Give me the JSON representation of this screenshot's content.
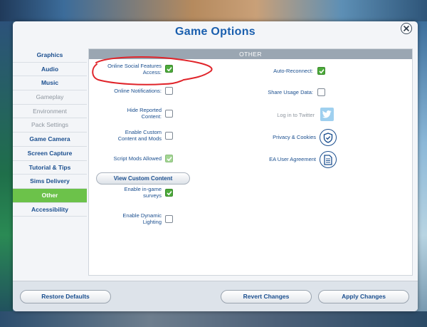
{
  "dialog": {
    "title": "Game Options",
    "close_icon": "close-icon"
  },
  "sidebar": {
    "items": [
      {
        "label": "Graphics",
        "state": "normal"
      },
      {
        "label": "Audio",
        "state": "normal"
      },
      {
        "label": "Music",
        "state": "normal"
      },
      {
        "label": "Gameplay",
        "state": "disabled"
      },
      {
        "label": "Environment",
        "state": "disabled"
      },
      {
        "label": "Pack Settings",
        "state": "disabled"
      },
      {
        "label": "Game Camera",
        "state": "normal"
      },
      {
        "label": "Screen Capture",
        "state": "normal"
      },
      {
        "label": "Tutorial & Tips",
        "state": "normal"
      },
      {
        "label": "Sims Delivery",
        "state": "normal"
      },
      {
        "label": "Other",
        "state": "active"
      },
      {
        "label": "Accessibility",
        "state": "normal"
      }
    ]
  },
  "panel": {
    "header": "Other",
    "left_options": [
      {
        "label": "Online Social Features Access:",
        "checked": true
      },
      {
        "label": "Online Notifications:",
        "checked": false
      },
      {
        "label": "Hide Reported Content:",
        "checked": false
      },
      {
        "label": "Enable Custom Content and Mods",
        "checked": false
      },
      {
        "label": "Script Mods Allowed",
        "checked": true,
        "disabled": true
      },
      {
        "label": "Enable in-game surveys",
        "checked": true
      },
      {
        "label": "Enable Dynamic Lighting",
        "checked": false
      }
    ],
    "view_custom_content": "View Custom Content",
    "right_options": {
      "auto_reconnect": {
        "label": "Auto-Reconnect:",
        "checked": true
      },
      "share_usage": {
        "label": "Share Usage Data:",
        "checked": false
      },
      "twitter": {
        "label": "Log in to Twitter",
        "icon": "twitter-icon"
      },
      "privacy": {
        "label": "Privacy & Cookies",
        "icon": "shield-check-icon"
      },
      "agreement": {
        "label": "EA User Agreement",
        "icon": "document-icon"
      }
    }
  },
  "footer": {
    "restore_defaults": "Restore Defaults",
    "revert_changes": "Revert Changes",
    "apply_changes": "Apply Changes"
  },
  "colors": {
    "accent": "#6cc24a",
    "text_blue": "#1b4f8f",
    "title_blue": "#1a5fae",
    "annotation_red": "#e0242a"
  }
}
